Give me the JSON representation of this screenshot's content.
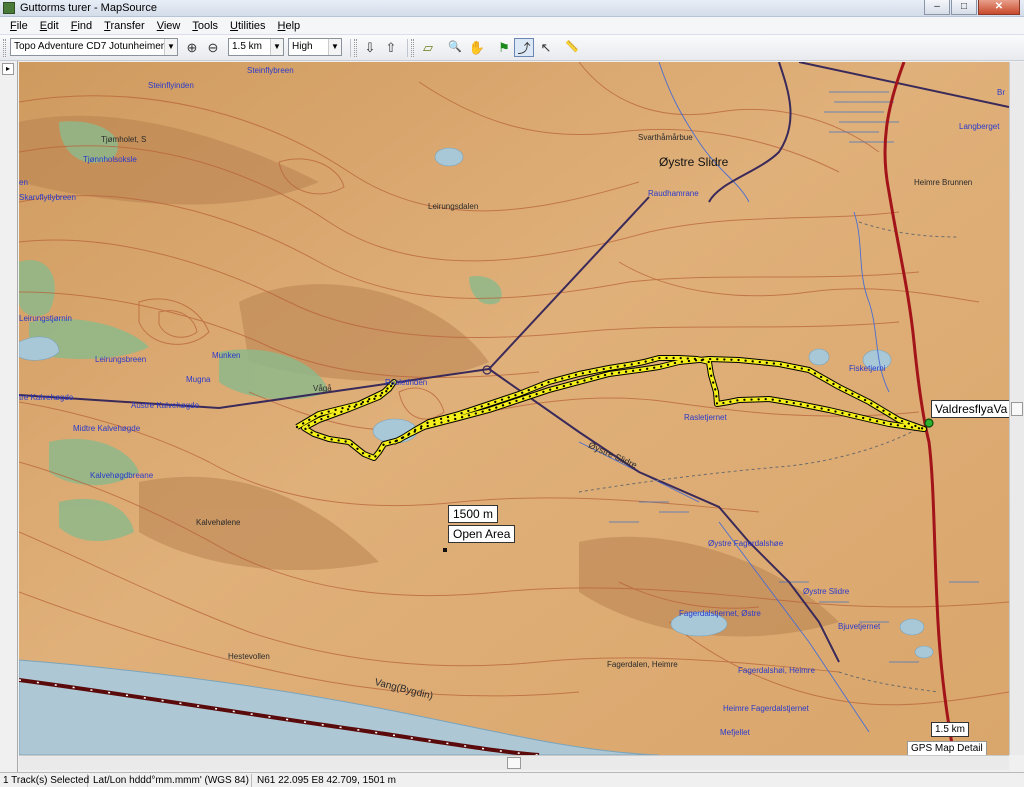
{
  "window": {
    "title": "Guttorms turer - MapSource",
    "buttons": {
      "minimize": "–",
      "maximize": "□",
      "close": "✕"
    }
  },
  "menu": [
    {
      "id": "file",
      "accel": "F",
      "rest": "ile"
    },
    {
      "id": "edit",
      "accel": "E",
      "rest": "dit"
    },
    {
      "id": "find",
      "accel": "F",
      "rest": "ind"
    },
    {
      "id": "transfer",
      "accel": "T",
      "rest": "ransfer"
    },
    {
      "id": "view",
      "accel": "V",
      "rest": "iew"
    },
    {
      "id": "tools",
      "accel": "T",
      "rest": "ools"
    },
    {
      "id": "utilities",
      "accel": "U",
      "rest": "tilities"
    },
    {
      "id": "help",
      "accel": "H",
      "rest": "elp"
    }
  ],
  "toolbar": {
    "map_product": "Topo Adventure CD7 Jotunheimen",
    "zoom_scale": "1.5 km",
    "detail_level": "High",
    "icons": {
      "zoom_in": "⊕",
      "zoom_out": "⊖",
      "receive": "⇩",
      "send": "⇧",
      "map_tool": "▱",
      "zoom_tool": "🔍",
      "hand_tool": "✋",
      "waypoint_tool": "⚑",
      "route_tool": "⤴",
      "selection_tool": "↖",
      "measure_tool": "📏"
    }
  },
  "map": {
    "labels": {
      "steinflybreen": "Steinflybreen",
      "steinflyinden": "Steinflyinden",
      "tjomholet": "Tjømholet, S",
      "tjonnholsoksle": "Tjønnholsoksle",
      "en": "en",
      "skarvflyt": "Skarvflyt­lybreen",
      "leirungsdalen": "Leirungsdalen",
      "svarthamarbue": "Svarthåmårbue",
      "oystre_slidre_top": "Øystre Slidre",
      "raudhamrane": "Raudhamrane",
      "leirungstjorn": "Leirungstjørnin",
      "leirungsbreen": "Leirungsbreen",
      "munken": "Munken",
      "mugna": "Mugna",
      "vaga": "Vågå",
      "rasletinden": "Rasletinden",
      "kalvehogde_w": "tre Kalvehøgde",
      "austre_kalvehogde": "Austre Kalvehøgde",
      "midtre_kalvehogde": "Midtre Kalvehøgde",
      "kalvehogdbreane": "Kalvehøgdbreane",
      "kalveholene": "Kalvehølene",
      "raslettjernet": "Rasletjernet",
      "fisketjerni": "Fisketjerni",
      "oystre_slidre_road": "Øystre Slidre",
      "oystre_fagerdalshoe": "Øystre Fagerdalshøe",
      "oystre_slidre_se": "Øystre Slidre",
      "fagerdalstjernet": "Fagerdalstjernet, Østre",
      "bjuvetjernet": "Bjuvetjernet",
      "fagerdalen": "Fagerdalen, Heimre",
      "fagerdalshoi": "Fagerdalshøi, Heimre",
      "heimre_fagerdal": "Heimre Fagerdalstjernet",
      "hestevollen": "Hestevollen",
      "vang": "Vang(Bygdin)",
      "mefjellet": "Mefjellet",
      "langberget": "Langberget",
      "heimrebrunnen": "Heimre Brunnen",
      "br": "Br"
    },
    "info_distance": "1500 m",
    "info_area": "Open Area",
    "waypoint": "ValdresflyaVa",
    "scale": "1.5 km",
    "detail_caption": "GPS Map Detail"
  },
  "status": {
    "selection": "1 Track(s) Selected",
    "position_format": "Lat/Lon hddd°mm.mmm' (WGS 84)",
    "cursor_position": "N61 22.095 E8 42.709, 1501 m"
  }
}
